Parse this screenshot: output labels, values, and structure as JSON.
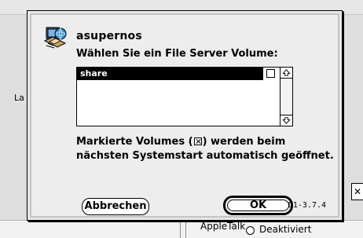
{
  "dialog": {
    "server_name": "asupernos",
    "instruction": "Wählen Sie ein File Server Volume:",
    "volumes": [
      {
        "name": "share",
        "selected": true,
        "checked": false
      }
    ],
    "note": {
      "line1_prefix": "Markierte Volumes (",
      "line1_suffix": ") werden beim",
      "line2": "nächsten Systemstart automatisch geöffnet."
    },
    "buttons": {
      "cancel_label": "Abbrechen",
      "ok_label": "OK"
    },
    "version": "D1-3.7.4",
    "icon": "server-chooser-icon"
  },
  "background": {
    "left_label": "La",
    "bottom_label_left": "AppleTalk",
    "bottom_label_right": "Deaktiviert"
  },
  "colors": {
    "dialog_background": "#e6e6e6",
    "selection_background": "#000000",
    "selection_text": "#ffffff"
  }
}
